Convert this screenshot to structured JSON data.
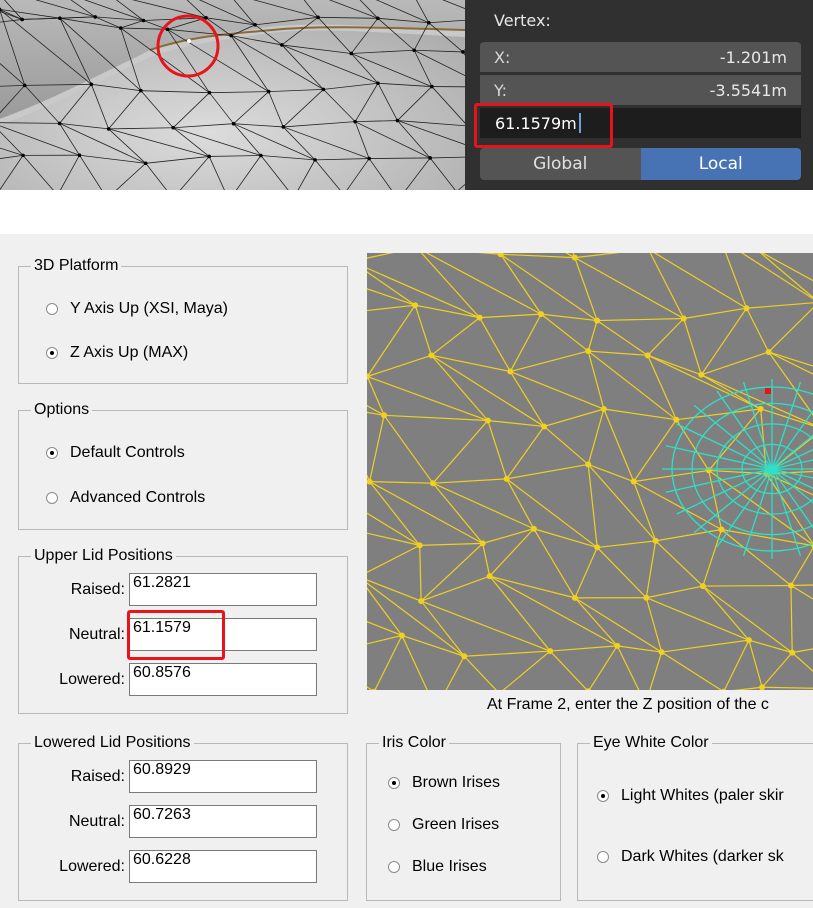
{
  "blender": {
    "vertex_header": "Vertex:",
    "x": {
      "label": "X:",
      "value": "-1.201m"
    },
    "y": {
      "label": "Y:",
      "value": "-3.5541m"
    },
    "z_edit_value": "61.1579m",
    "toggle": {
      "global": "Global",
      "local": "Local",
      "active": "Local"
    },
    "colors": {
      "panel_bg": "#303030",
      "field_bg": "#545454",
      "active_blue": "#4772b3",
      "highlight_red": "#e8141b"
    }
  },
  "dialog": {
    "platform": {
      "title": "3D Platform",
      "options": [
        {
          "label": "Y Axis Up (XSI, Maya)",
          "selected": false
        },
        {
          "label": "Z Axis Up (MAX)",
          "selected": true
        }
      ]
    },
    "options_group": {
      "title": "Options",
      "options": [
        {
          "label": "Default Controls",
          "selected": true
        },
        {
          "label": "Advanced Controls",
          "selected": false
        }
      ]
    },
    "upper_lid": {
      "title": "Upper Lid Positions",
      "raised": {
        "label": "Raised:",
        "value": "61.2821"
      },
      "neutral": {
        "label": "Neutral:",
        "value": "61.1579"
      },
      "lowered": {
        "label": "Lowered:",
        "value": "60.8576"
      }
    },
    "lower_lid": {
      "title": "Lowered Lid Positions",
      "raised": {
        "label": "Raised:",
        "value": "60.8929"
      },
      "neutral": {
        "label": "Neutral:",
        "value": "60.7263"
      },
      "lowered": {
        "label": "Lowered:",
        "value": "60.6228"
      }
    },
    "caption": "At Frame 2, enter the Z position of the c",
    "iris": {
      "title": "Iris Color",
      "options": [
        {
          "label": "Brown Irises",
          "selected": true
        },
        {
          "label": "Green Irises",
          "selected": false
        },
        {
          "label": "Blue Irises",
          "selected": false
        }
      ]
    },
    "eye_white": {
      "title": "Eye White Color",
      "options": [
        {
          "label": "Light Whites (paler skir",
          "selected": true
        },
        {
          "label": "Dark Whites (darker sk",
          "selected": false
        }
      ]
    },
    "colors": {
      "wire_yellow": "#f0d020",
      "eye_cyan": "#2ee0c8",
      "preview_bg": "#7f7f7f"
    }
  }
}
